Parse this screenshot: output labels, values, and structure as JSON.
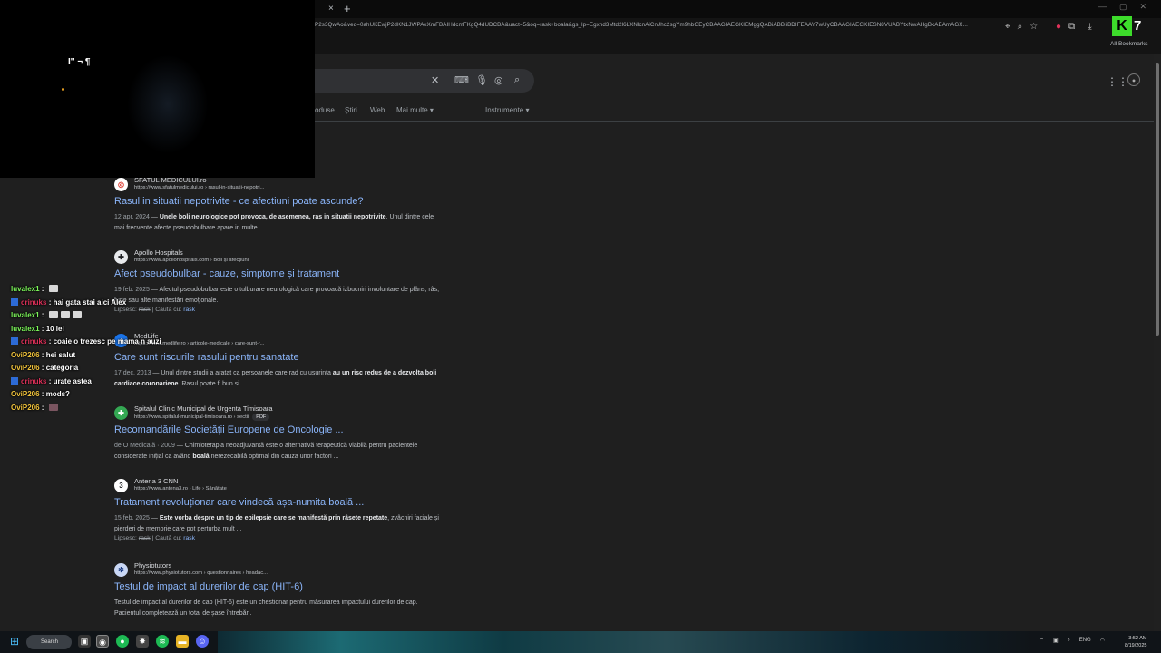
{
  "browser": {
    "tab_close": "×",
    "tab_new": "+",
    "url": "P2s3QwAo&ved=0ahUKEwjP2dKN1JWPAxXmFBAIHdcmFKgQ4dUDCBA&uact=5&oq=rask+boala&gs_lp=Egxnd3Mtd2l6LXNlcnAiCnJhc2sgYm9hbGEyCBAAGIAEGKIEMggQABiABBiiBDIFEAAY7wUyCBAAGIAEGKIESN8VUABYtxNwAHgBkAEAmAGX...",
    "all_bookmarks": "All Bookmarks",
    "ext_badge": "7"
  },
  "search": {
    "nav_tabs": [
      "oduse",
      "Știri",
      "Web",
      "Mai multe ▾",
      "Instrumente ▾"
    ]
  },
  "webcam": {
    "overlay_text": "I'' ¬ ¶"
  },
  "results": [
    {
      "site": "SFATUL MEDICULUI.ro",
      "crumb": "https://www.sfatulmedicului.ro › rasul-in-situatii-nepotri...",
      "title": "Rasul in situatii nepotrivite - ce afectiuni poate ascunde?",
      "date": "12 apr. 2024",
      "snippet_bold": "Unele boli neurologice pot provoca, de asemenea, ras in situatii nepotrivite",
      "snippet_rest": ". Unul dintre cele mai frecvente afecte pseudobulbare apare in multe ..."
    },
    {
      "site": "Apollo Hospitals",
      "crumb": "https://www.apollohospitals.com › Boli și afecțiuni",
      "title": "Afect pseudobulbar - cauze, simptome și tratament",
      "date": "19 feb. 2025",
      "snippet_rest": " — Afectul pseudobulbar este o tulburare neurologică care provoacă izbucniri involuntare de plâns, râs, furie sau alte manifestări emoționale.",
      "missing_label": "Lipsesc:",
      "missing_word": "rask",
      "search_with": "Caută cu:",
      "search_link": "rask"
    },
    {
      "site": "MedLife",
      "crumb": "https://www.medlife.ro › articole-medicale › care-sunt-r...",
      "title": "Care sunt riscurile rasului pentru sanatate",
      "date": "17 dec. 2013",
      "snippet_pre": " — Unul dintre studii a aratat ca persoanele care rad cu usurinta ",
      "snippet_bold": "au un risc redus de a dezvolta boli cardiace coronariene",
      "snippet_rest": ". Rasul poate fi bun si ..."
    },
    {
      "site": "Spitalul Clinic Municipal de Urgenta Timisoara",
      "crumb": "https://www.spitalul-municipal-timisoara.ro › sectii",
      "pdf": "PDF",
      "title": "Recomandările Societății Europene de Oncologie ...",
      "date": "de O Medicală · 2009",
      "snippet_pre": " — Chimioterapia neoadjuvantă este o alternativă terapeutică viabilă pentru pacientele considerate inițial ca având ",
      "snippet_bold": "boală",
      "snippet_rest": " nerezecabilă optimal din cauza unor factori ..."
    },
    {
      "site": "Antena 3 CNN",
      "crumb": "https://www.antena3.ro › Life › Sănătate",
      "title": "Tratament revoluționar care vindecă așa-numita boală ...",
      "date": "15 feb. 2025",
      "snippet_bold": "Este vorba despre un tip de epilepsie care se manifestă prin râsete repetate",
      "snippet_rest": ", zvâcniri faciale și pierderi de memorie care pot perturba mult ...",
      "missing_label": "Lipsesc:",
      "missing_word": "rask",
      "search_with": "Caută cu:",
      "search_link": "rask"
    },
    {
      "site": "Physiotutors",
      "crumb": "https://www.physiotutors.com › questionnaires › headac...",
      "title": "Testul de impact al durerilor de cap (HIT-6)",
      "snippet_rest": "Testul de impact al durerilor de cap (HIT-6) este un chestionar pentru măsurarea impactului durerilor de cap. Pacientul completează un total de șase întrebări."
    }
  ],
  "chat": [
    {
      "user": "luvalex1",
      "color": "#7cf55a",
      "msg": "",
      "badge": false,
      "emotes": 1
    },
    {
      "user": "crinuks",
      "color": "#e0315a",
      "msg": "hai gata stai aici Alex",
      "badge": true,
      "emotes": 0
    },
    {
      "user": "luvalex1",
      "color": "#7cf55a",
      "msg": "",
      "badge": false,
      "emotes": 3
    },
    {
      "user": "luvalex1",
      "color": "#7cf55a",
      "msg": "10 lei",
      "badge": false,
      "emotes": 0
    },
    {
      "user": "crinuks",
      "color": "#e0315a",
      "msg": "coaie o trezesc pe mama n auzi",
      "badge": true,
      "emotes": 0
    },
    {
      "user": "OviP206",
      "color": "#f0c23b",
      "msg": "hei salut",
      "badge": false,
      "emotes": 0
    },
    {
      "user": "OviP206",
      "color": "#f0c23b",
      "msg": "categoria",
      "badge": false,
      "emotes": 0
    },
    {
      "user": "crinuks",
      "color": "#e0315a",
      "msg": "urate astea",
      "badge": true,
      "emotes": 0
    },
    {
      "user": "OviP206",
      "color": "#f0c23b",
      "msg": "mods?",
      "badge": false,
      "emotes": 0
    },
    {
      "user": "OviP206",
      "color": "#f0c23b",
      "msg": "",
      "badge": false,
      "emotes": 1,
      "emote_dark": true
    }
  ],
  "taskbar": {
    "search_label": "Search",
    "clock_time": "3:52 AM",
    "clock_date": "8/19/2025",
    "lang": "ENG"
  }
}
